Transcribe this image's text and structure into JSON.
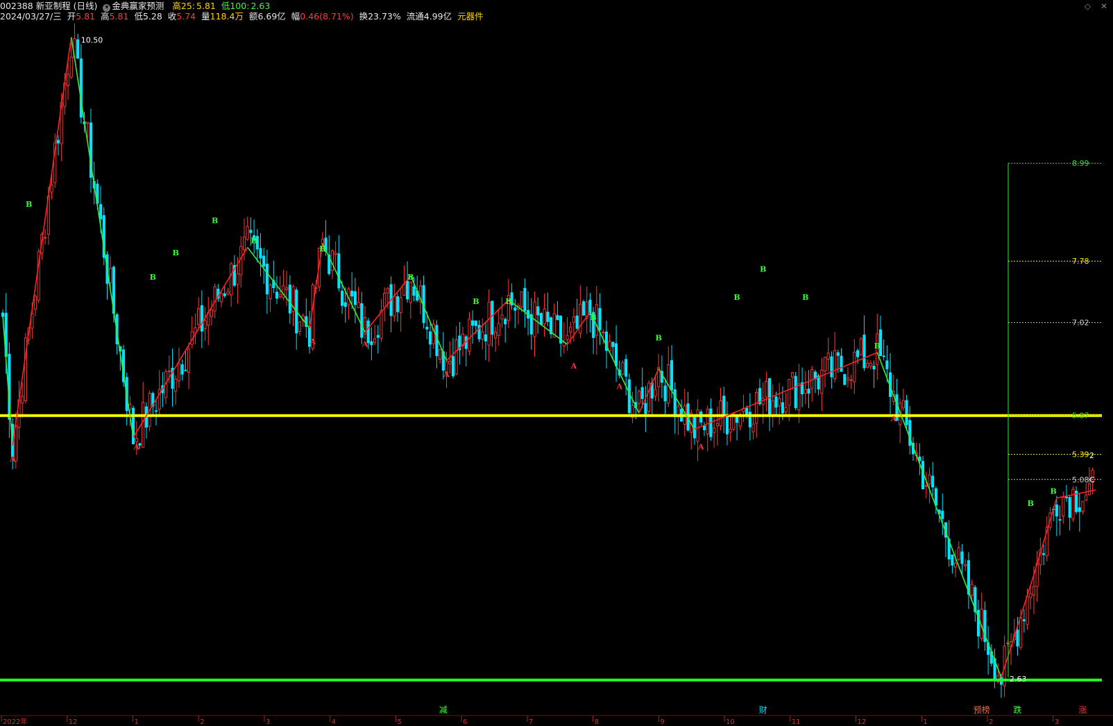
{
  "header": {
    "code_name": "002388 新亚制程 (日线)",
    "indicator": "金典赢家预测",
    "high25_label": "高25:",
    "high25": "5.81",
    "low100_label": "低100:",
    "low100": "2.63",
    "date": "2024/03/27/三",
    "open_label": "开",
    "open": "5.81",
    "high_label": "高",
    "high": "5.81",
    "low_label": "低",
    "low": "5.28",
    "close_label": "收",
    "close": "5.74",
    "vol_label": "量",
    "vol": "118.4万",
    "amount_label": "额",
    "amount": "6.69亿",
    "chg_label": "幅",
    "chg": "0.46(8.71%)",
    "turnover_label": "换",
    "turnover": "23.73%",
    "float_label": "流通",
    "float_cap": "4.99亿",
    "tool": "元器件"
  },
  "colors": {
    "up": "#ff3b3b",
    "down": "#00e5ff",
    "zig_up": "#ff2222",
    "zig_down": "#33ee33",
    "hline_yellow": "#ffff00",
    "hline_green": "#22ff22"
  },
  "chart_data": {
    "type": "candlestick",
    "title": "002388 新亚制程 (日线)",
    "ylim": [
      2.4,
      10.7
    ],
    "max_label": "10.50",
    "min_label": "2.63",
    "x_months": [
      "2022年",
      "12",
      "1",
      "2",
      "3",
      "4",
      "5",
      "6",
      "7",
      "8",
      "9",
      "10",
      "11",
      "12",
      "1",
      "2",
      "3"
    ],
    "horizontal_lines": [
      {
        "value": 5.87,
        "color": "#ffff00"
      },
      {
        "value": 2.6,
        "color": "#22ff22"
      }
    ],
    "target_levels": [
      {
        "label": "8.99",
        "value": 8.99,
        "color": "#33dd33"
      },
      {
        "label": "7.78",
        "value": 7.78,
        "color": "#ffee00"
      },
      {
        "label": "7.02",
        "value": 7.02,
        "color": "#cccccc"
      },
      {
        "label": "5.87",
        "value": 5.87,
        "color": "#33dd33"
      },
      {
        "label": "5.39",
        "value": 5.39,
        "color": "#ffee00"
      },
      {
        "label": "5.08",
        "value": 5.08,
        "color": "#cccccc"
      }
    ],
    "zigzag": [
      {
        "i": 0,
        "p": 7.1
      },
      {
        "i": 3,
        "p": 5.5,
        "label": "A"
      },
      {
        "i": 21,
        "p": 10.55
      },
      {
        "i": 40,
        "p": 5.6,
        "label": "A"
      },
      {
        "i": 75,
        "p": 7.95
      },
      {
        "i": 94,
        "p": 6.95,
        "label": "A"
      },
      {
        "i": 98,
        "p": 8.0
      },
      {
        "i": 111,
        "p": 6.9,
        "label": "A"
      },
      {
        "i": 125,
        "p": 7.6
      },
      {
        "i": 136,
        "p": 6.55,
        "label": "A"
      },
      {
        "i": 155,
        "p": 7.3
      },
      {
        "i": 173,
        "p": 6.75
      },
      {
        "i": 180,
        "p": 7.15
      },
      {
        "i": 195,
        "p": 5.9
      },
      {
        "i": 201,
        "p": 6.45
      },
      {
        "i": 212,
        "p": 5.7,
        "label": "A"
      },
      {
        "i": 268,
        "p": 6.65
      },
      {
        "i": 306,
        "p": 2.63
      },
      {
        "i": 316,
        "p": 3.9
      },
      {
        "i": 323,
        "p": 4.85
      },
      {
        "i": 335,
        "p": 4.95
      }
    ],
    "b_labels": [
      {
        "i": 8,
        "p": 8.45
      },
      {
        "i": 46,
        "p": 7.55
      },
      {
        "i": 53,
        "p": 7.85
      },
      {
        "i": 65,
        "p": 8.25
      },
      {
        "i": 77,
        "p": 8.0
      },
      {
        "i": 98,
        "p": 7.9
      },
      {
        "i": 125,
        "p": 7.55
      },
      {
        "i": 145,
        "p": 7.25
      },
      {
        "i": 155,
        "p": 7.25
      },
      {
        "i": 181,
        "p": 7.05
      },
      {
        "i": 201,
        "p": 6.8
      },
      {
        "i": 225,
        "p": 7.3
      },
      {
        "i": 233,
        "p": 7.65
      },
      {
        "i": 246,
        "p": 7.3
      },
      {
        "i": 268,
        "p": 6.7
      },
      {
        "i": 315,
        "p": 4.75
      },
      {
        "i": 322,
        "p": 4.9
      }
    ],
    "a_labels": [
      {
        "i": 3,
        "p": 5.3
      },
      {
        "i": 41,
        "p": 5.45
      },
      {
        "i": 95,
        "p": 6.75
      },
      {
        "i": 111,
        "p": 6.72
      },
      {
        "i": 136,
        "p": 6.35
      },
      {
        "i": 175,
        "p": 6.45
      },
      {
        "i": 189,
        "p": 6.2
      },
      {
        "i": 214,
        "p": 5.45
      },
      {
        "i": 273,
        "p": 5.8
      }
    ],
    "bottom_markers": [
      {
        "label": "减",
        "i": 135,
        "color": "#33ff33"
      },
      {
        "label": "财",
        "i": 233,
        "color": "#00ddff"
      },
      {
        "label": "预榜",
        "i": 300,
        "color": "#ff6633"
      },
      {
        "label": "跌",
        "i": 311,
        "color": "#33ff33"
      },
      {
        "label": "涨",
        "i": 331,
        "color": "#ff3333"
      }
    ],
    "last_labels": [
      {
        "label": "2",
        "value": 5.38
      },
      {
        "label": "C",
        "value": 5.08
      }
    ]
  }
}
